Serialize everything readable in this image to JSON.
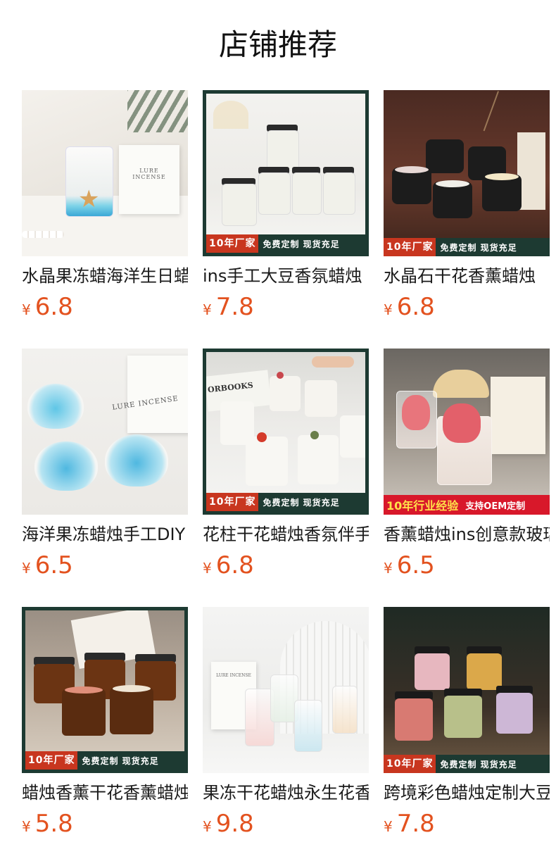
{
  "page": {
    "title": "店铺推荐"
  },
  "currency_symbol": "¥",
  "products": [
    {
      "title": "水晶果冻蜡海洋生日蜡烛",
      "price": "6.8",
      "image_text": "LURE INCENSE",
      "banner": null
    },
    {
      "title": "ins手工大豆香氛蜡烛",
      "price": "7.8",
      "image_text": "",
      "banner": {
        "style": "green",
        "red_text": "10年厂家",
        "text": "免费定制 现货充足"
      }
    },
    {
      "title": "水晶石干花香薰蜡烛",
      "price": "6.8",
      "image_text": "",
      "banner": {
        "style": "green",
        "red_text": "10年厂家",
        "text": "免费定制 现货充足"
      }
    },
    {
      "title": "海洋果冻蜡烛手工DIY",
      "price": "6.5",
      "image_text": "LURE INCENSE",
      "banner": null
    },
    {
      "title": "花柱干花蜡烛香氛伴手礼",
      "price": "6.8",
      "image_text": "ORBOOKS",
      "banner": {
        "style": "green",
        "red_text": "10年厂家",
        "text": "免费定制 现货充足"
      }
    },
    {
      "title": "香薰蜡烛ins创意款玻璃杯",
      "price": "6.5",
      "image_text": "",
      "banner": {
        "style": "red",
        "red_text": "10年行业经验",
        "text": "支持OEM定制"
      }
    },
    {
      "title": "蜡烛香薰干花香薰蜡烛",
      "price": "5.8",
      "image_text": "",
      "banner": {
        "style": "green",
        "red_text": "10年厂家",
        "text": "免费定制 现货充足"
      }
    },
    {
      "title": "果冻干花蜡烛永生花香薰",
      "price": "9.8",
      "image_text": "LURE INCENSE",
      "banner": null
    },
    {
      "title": "跨境彩色蜡烛定制大豆蜡",
      "price": "7.8",
      "image_text": "",
      "banner": {
        "style": "green",
        "red_text": "10年厂家",
        "text": "免费定制 现货充足"
      }
    }
  ],
  "colors": {
    "price": "#e3521f",
    "banner_green": "#1d3a32",
    "banner_red": "#c8361f",
    "banner_alt_red": "#d8182a",
    "banner_alt_yellow": "#ffe14a"
  }
}
